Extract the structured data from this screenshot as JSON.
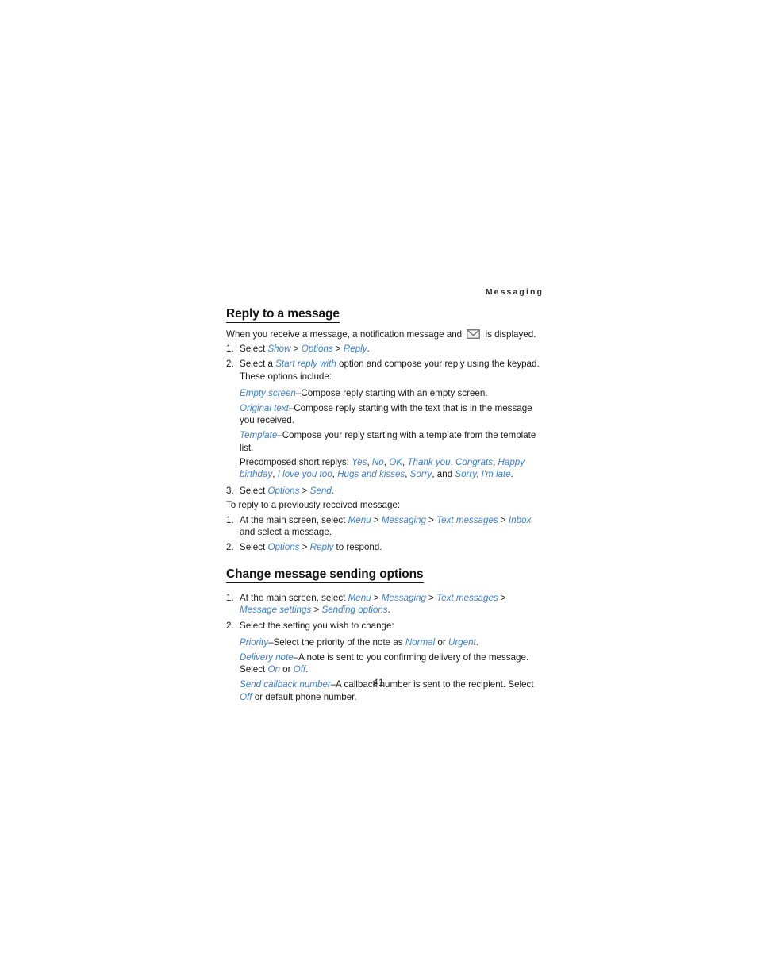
{
  "page": {
    "running_header": "Messaging",
    "folio": "41"
  },
  "section1": {
    "heading": "Reply to a message",
    "intro_before_icon": "When you receive a message, a notification message and",
    "icon": "envelope-icon",
    "intro_after_icon": "is displayed.",
    "steps": [
      {
        "num": "1.",
        "parts": [
          {
            "text": "Select ",
            "style": "plain"
          },
          {
            "text": "Show",
            "style": "ui"
          },
          {
            "text": " > ",
            "style": "sep"
          },
          {
            "text": "Options",
            "style": "ui"
          },
          {
            "text": " > ",
            "style": "sep"
          },
          {
            "text": "Reply",
            "style": "ui"
          },
          {
            "text": ".",
            "style": "plain"
          }
        ]
      },
      {
        "num": "2.",
        "parts": [
          {
            "text": "Select a ",
            "style": "plain"
          },
          {
            "text": "Start reply with",
            "style": "ui"
          },
          {
            "text": " option and compose your reply using the keypad. These options include:",
            "style": "plain"
          }
        ]
      }
    ],
    "options": [
      {
        "term": "Empty screen",
        "dash": "–",
        "desc": "Compose reply starting with an empty screen."
      },
      {
        "term": "Original text",
        "dash": "–",
        "desc": "Compose reply starting with the text that is in the message you received."
      },
      {
        "term": "Template",
        "dash": "–",
        "desc": "Compose your reply starting with a template from the template list."
      }
    ],
    "precomposed": {
      "label": "Precomposed short replys: ",
      "items": [
        "Yes",
        "No",
        "OK",
        "Thank you",
        "Congrats",
        "Happy birthday",
        "I love you too",
        "Hugs and kisses",
        "Sorry"
      ],
      "conjunction": "and ",
      "last_item": "Sorry, I'm late",
      "terminator": "."
    },
    "step3": {
      "num": "3.",
      "parts": [
        {
          "text": "Select ",
          "style": "plain"
        },
        {
          "text": "Options",
          "style": "ui"
        },
        {
          "text": " > ",
          "style": "sep"
        },
        {
          "text": "Send",
          "style": "ui"
        },
        {
          "text": ".",
          "style": "plain"
        }
      ]
    },
    "subintro": "To reply to a previously received message:",
    "steps_b": [
      {
        "num": "1.",
        "parts": [
          {
            "text": "At the main screen, select ",
            "style": "plain"
          },
          {
            "text": "Menu",
            "style": "ui"
          },
          {
            "text": " > ",
            "style": "sep"
          },
          {
            "text": "Messaging",
            "style": "ui"
          },
          {
            "text": " > ",
            "style": "sep"
          },
          {
            "text": "Text messages",
            "style": "ui"
          },
          {
            "text": " > ",
            "style": "sep"
          },
          {
            "text": "Inbox",
            "style": "ui"
          },
          {
            "text": " and select a message.",
            "style": "plain"
          }
        ]
      },
      {
        "num": "2.",
        "parts": [
          {
            "text": "Select ",
            "style": "plain"
          },
          {
            "text": "Options",
            "style": "ui"
          },
          {
            "text": " > ",
            "style": "sep"
          },
          {
            "text": "Reply",
            "style": "ui"
          },
          {
            "text": " to respond.",
            "style": "plain"
          }
        ]
      }
    ]
  },
  "section2": {
    "heading": "Change message sending options",
    "steps": [
      {
        "num": "1.",
        "parts": [
          {
            "text": "At the main screen, select ",
            "style": "plain"
          },
          {
            "text": "Menu",
            "style": "ui"
          },
          {
            "text": " > ",
            "style": "sep"
          },
          {
            "text": "Messaging",
            "style": "ui"
          },
          {
            "text": " > ",
            "style": "sep"
          },
          {
            "text": "Text messages",
            "style": "ui"
          },
          {
            "text": " > ",
            "style": "sep"
          },
          {
            "text": "Message settings",
            "style": "ui"
          },
          {
            "text": " > ",
            "style": "sep"
          },
          {
            "text": "Sending options",
            "style": "ui"
          },
          {
            "text": ".",
            "style": "plain"
          }
        ]
      },
      {
        "num": "2.",
        "parts": [
          {
            "text": "Select the setting you wish to change:",
            "style": "plain"
          }
        ]
      }
    ],
    "settings": [
      {
        "term": "Priority",
        "dash": "–",
        "parts": [
          {
            "text": "Select the priority of the note as ",
            "style": "plain"
          },
          {
            "text": "Normal",
            "style": "ui"
          },
          {
            "text": " or ",
            "style": "plain"
          },
          {
            "text": "Urgent",
            "style": "ui"
          },
          {
            "text": ".",
            "style": "plain"
          }
        ]
      },
      {
        "term": "Delivery note",
        "dash": "–",
        "parts": [
          {
            "text": "A note is sent to you confirming delivery of the message. Select ",
            "style": "plain"
          },
          {
            "text": "On",
            "style": "ui"
          },
          {
            "text": " or ",
            "style": "plain"
          },
          {
            "text": "Off",
            "style": "ui"
          },
          {
            "text": ".",
            "style": "plain"
          }
        ]
      },
      {
        "term": "Send callback number",
        "dash": "–",
        "parts": [
          {
            "text": "A callback number is sent to the recipient. Select ",
            "style": "plain"
          },
          {
            "text": "Off",
            "style": "ui"
          },
          {
            "text": " or default phone number.",
            "style": "plain"
          }
        ]
      }
    ]
  },
  "colors": {
    "ui_link": "#3c7fd1",
    "body_text": "#1a1a1a",
    "icon_outline": "#6f6f6f"
  }
}
